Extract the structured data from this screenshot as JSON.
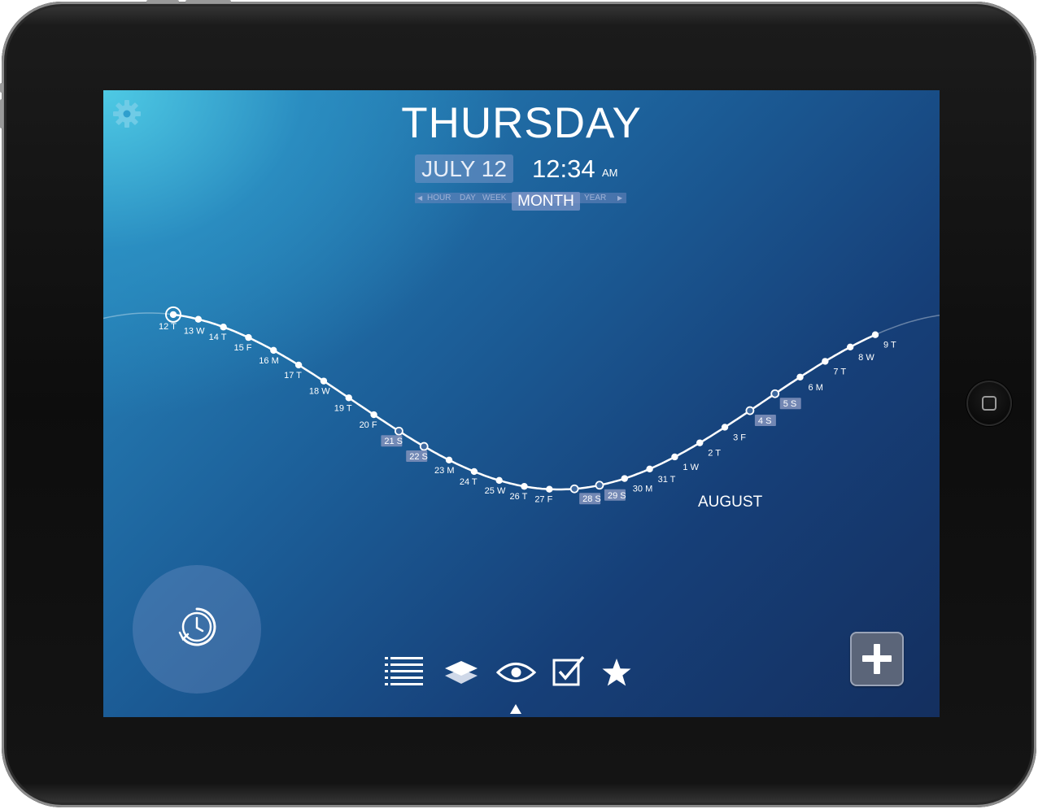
{
  "header": {
    "weekday": "THURSDAY",
    "date": "JULY 12",
    "time": "12:34",
    "ampm": "AM"
  },
  "zoom": {
    "options": [
      "HOUR",
      "DAY",
      "WEEK",
      "MONTH",
      "YEAR"
    ],
    "selected": "MONTH"
  },
  "timeline": {
    "month_label": "AUGUST",
    "days": [
      {
        "label": "12 T",
        "current": true
      },
      {
        "label": "13 W"
      },
      {
        "label": "14 T"
      },
      {
        "label": "15 F"
      },
      {
        "label": "16 M"
      },
      {
        "label": "17 T"
      },
      {
        "label": "18 W"
      },
      {
        "label": "19 T"
      },
      {
        "label": "20 F"
      },
      {
        "label": "21 S",
        "weekend": true
      },
      {
        "label": "22 S",
        "weekend": true
      },
      {
        "label": "23 M"
      },
      {
        "label": "24 T"
      },
      {
        "label": "25 W"
      },
      {
        "label": "26 T"
      },
      {
        "label": "27 F"
      },
      {
        "label": "28 S",
        "weekend": true
      },
      {
        "label": "29 S",
        "weekend": true
      },
      {
        "label": "30 M"
      },
      {
        "label": "31 T"
      },
      {
        "label": "1 W"
      },
      {
        "label": "2 T"
      },
      {
        "label": "3 F"
      },
      {
        "label": "4 S",
        "weekend": true
      },
      {
        "label": "5 S",
        "weekend": true
      },
      {
        "label": "6 M"
      },
      {
        "label": "7 T"
      },
      {
        "label": "8 W"
      },
      {
        "label": "9 T"
      }
    ]
  },
  "toolbar": {
    "icons": [
      "list-icon",
      "layers-icon",
      "eye-icon",
      "checkbox-icon",
      "star-icon"
    ],
    "selected": "eye-icon"
  },
  "colors": {
    "accent": "#5b6579",
    "gear": "#6fcbe6",
    "weekend_box": "#7d8fb9"
  }
}
